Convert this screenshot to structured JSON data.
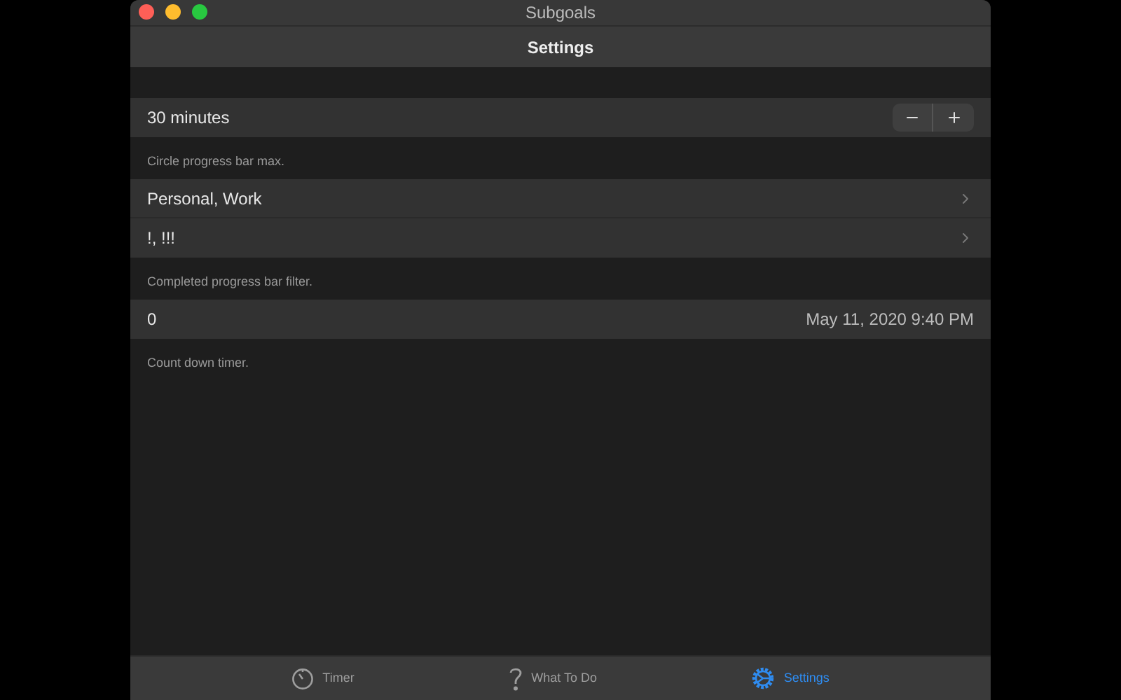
{
  "window": {
    "title": "Subgoals"
  },
  "nav": {
    "title": "Settings"
  },
  "sections": [
    {
      "rows": [
        {
          "kind": "stepper",
          "label": "30 minutes"
        }
      ],
      "footer": "Circle progress bar max."
    },
    {
      "rows": [
        {
          "kind": "disclosure",
          "label": "Personal, Work"
        },
        {
          "kind": "disclosure",
          "label": "!, !!!"
        }
      ],
      "footer": "Completed progress bar filter."
    },
    {
      "rows": [
        {
          "kind": "value",
          "label": "0",
          "value": "May 11, 2020 9:40 PM"
        }
      ],
      "footer": "Count down timer."
    }
  ],
  "tabs": [
    {
      "kind": "timer",
      "label": "Timer",
      "selected": false
    },
    {
      "kind": "help",
      "label": "What To Do",
      "selected": false
    },
    {
      "kind": "settings",
      "label": "Settings",
      "selected": true
    }
  ]
}
